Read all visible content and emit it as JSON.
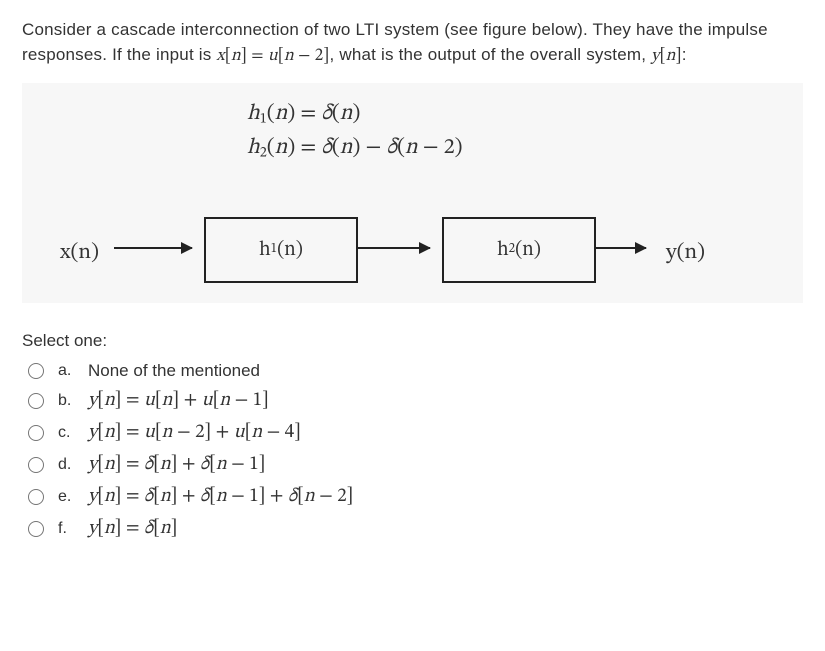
{
  "question_html": "Consider a cascade interconnection of two LTI system (see figure below). They have the impulse responses. If the input is <span class='math'>x<span class='up'>[</span>n<span class='up'>]</span> <span class='up'>=</span> u<span class='up'>[</span>n <span class='up'>−</span> <span class='up'>2]</span></span>, what is the output of the overall system, <span class='math'>y<span class='up'>[</span>n<span class='up'>]</span></span>:",
  "figure": {
    "eq1_html": "h<sub>1</sub><span class='up'>(</span>n<span class='up'>) = </span>δ<span class='up'>(</span>n<span class='up'>)</span>",
    "eq2_html": "h<sub>2</sub><span class='up'>(</span>n<span class='up'>) = </span>δ<span class='up'>(</span>n<span class='up'>) − </span>δ<span class='up'>(</span>n <span class='up'>− 2)</span>",
    "x_label": "x(n)",
    "box1_html": "h<sub>1</sub>(n)",
    "box2_html": "h<sub>2</sub>(n)",
    "y_label": "y(n)"
  },
  "select_label": "Select one:",
  "options": [
    {
      "letter": "a.",
      "html": "None of the mentioned",
      "plain": true
    },
    {
      "letter": "b.",
      "html": "y<span class='up'>[</span>n<span class='up'>] = </span>u<span class='up'>[</span>n<span class='up'>] + </span>u<span class='up'>[</span>n <span class='up'>− 1]</span>"
    },
    {
      "letter": "c.",
      "html": "y<span class='up'>[</span>n<span class='up'>] = </span>u<span class='up'>[</span>n <span class='up'>− 2] + </span>u<span class='up'>[</span>n <span class='up'>− 4]</span>"
    },
    {
      "letter": "d.",
      "html": "y<span class='up'>[</span>n<span class='up'>] = </span>δ<span class='up'>[</span>n<span class='up'>] + </span>δ<span class='up'>[</span>n <span class='up'>− 1]</span>"
    },
    {
      "letter": "e.",
      "html": "y<span class='up'>[</span>n<span class='up'>] = </span>δ<span class='up'>[</span>n<span class='up'>] + </span>δ<span class='up'>[</span>n <span class='up'>− 1] + </span>δ<span class='up'>[</span>n <span class='up'>− 2]</span>"
    },
    {
      "letter": "f.",
      "html": "y<span class='up'>[</span>n<span class='up'>] = </span>δ<span class='up'>[</span>n<span class='up'>]</span>"
    }
  ]
}
